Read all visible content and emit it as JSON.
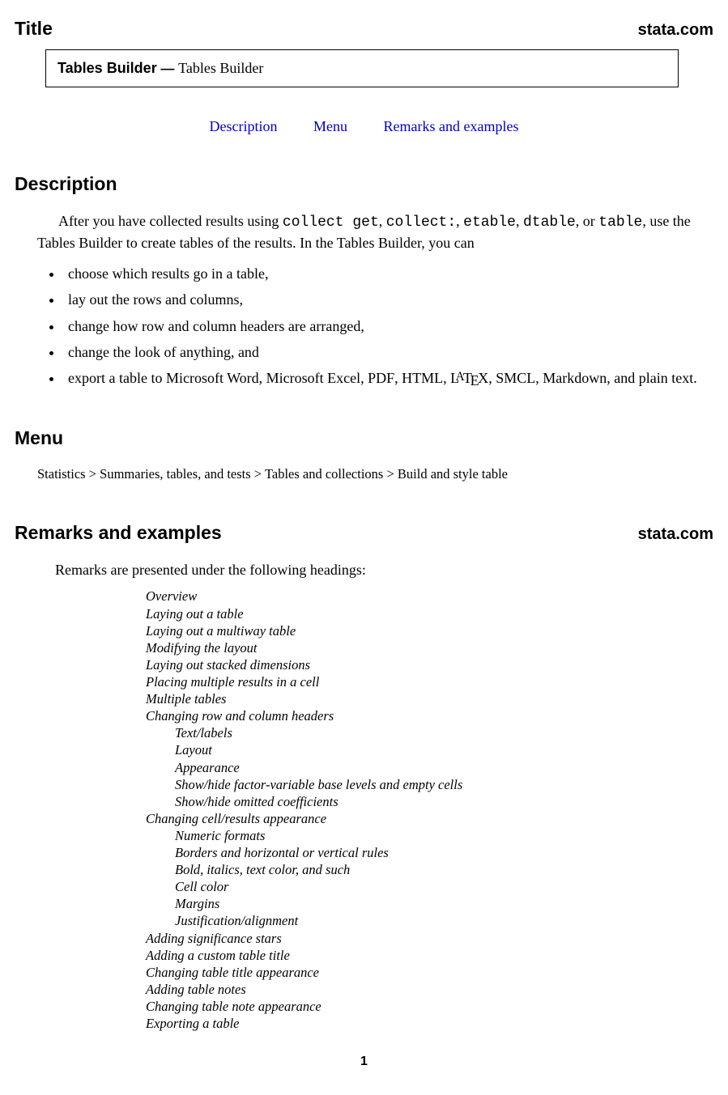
{
  "title_section": {
    "label": "Title",
    "brand": "stata.com",
    "box_name": "Tables Builder",
    "box_sep": " — ",
    "box_desc": "Tables Builder"
  },
  "toc": {
    "description": "Description",
    "menu": "Menu",
    "remarks": "Remarks and examples"
  },
  "description": {
    "heading": "Description",
    "p1a": "After you have collected results using ",
    "c1": "collect get",
    "p1b": ", ",
    "c2": "collect:",
    "p1c": ", ",
    "c3": "etable",
    "p1d": ", ",
    "c4": "dtable",
    "p1e": ", or ",
    "c5": "table",
    "p1f": ", use the Tables Builder to create tables of the results. In the Tables Builder, you can",
    "bullets": {
      "b1": "choose which results go in a table,",
      "b2": "lay out the rows and columns,",
      "b3": "change how row and column headers are arranged,",
      "b4": "change the look of anything, and",
      "b5a": "export a table to Microsoft Word, Microsoft Excel, ",
      "b5_pdf": "PDF",
      "b5b": ", ",
      "b5_html": "HTML",
      "b5c": ", ",
      "b5d": ", ",
      "b5_smcl": "SMCL",
      "b5e": ", Markdown, and plain text."
    }
  },
  "menu": {
    "heading": "Menu",
    "s1": "Statistics",
    "sep": " > ",
    "s2": "Summaries, tables, and tests",
    "s3": "Tables and collections",
    "s4": "Build and style table"
  },
  "remarks": {
    "heading": "Remarks and examples",
    "brand": "stata.com",
    "intro": "Remarks are presented under the following headings:",
    "items": {
      "r1": "Overview",
      "r2": "Laying out a table",
      "r3": "Laying out a multiway table",
      "r4": "Modifying the layout",
      "r5": "Laying out stacked dimensions",
      "r6": "Placing multiple results in a cell",
      "r7": "Multiple tables",
      "r8": "Changing row and column headers",
      "r8a": "Text/labels",
      "r8b": "Layout",
      "r8c": "Appearance",
      "r8d": "Show/hide factor-variable base levels and empty cells",
      "r8e": "Show/hide omitted coefficients",
      "r9": "Changing cell/results appearance",
      "r9a": "Numeric formats",
      "r9b": "Borders and horizontal or vertical rules",
      "r9c": "Bold, italics, text color, and such",
      "r9d": "Cell color",
      "r9e": "Margins",
      "r9f": "Justification/alignment",
      "r10": "Adding significance stars",
      "r11": "Adding a custom table title",
      "r12": "Changing table title appearance",
      "r13": "Adding table notes",
      "r14": "Changing table note appearance",
      "r15": "Exporting a table"
    }
  },
  "page": "1"
}
